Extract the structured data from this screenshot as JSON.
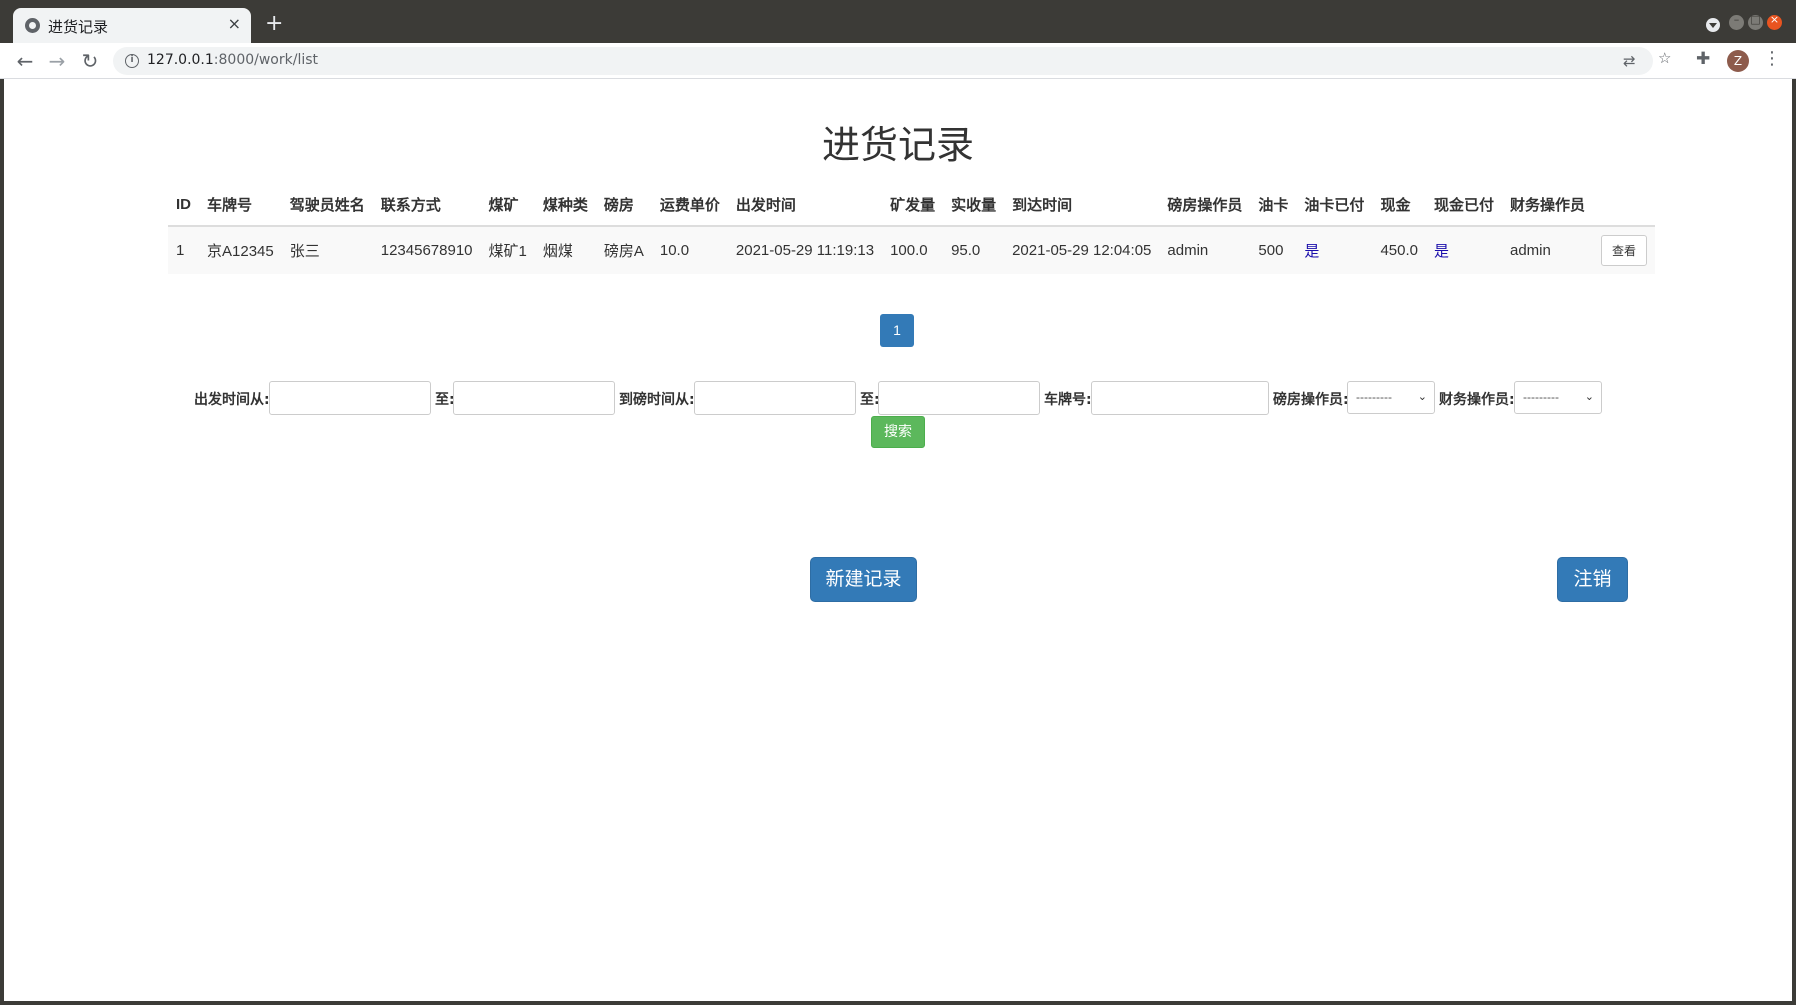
{
  "browser": {
    "tab_title": "进货记录",
    "tab_close": "×",
    "new_tab": "+",
    "url_host": "127.0.0.1",
    "url_path": ":8000/work/list",
    "avatar_letter": "Z",
    "icons": [
      "back-icon",
      "forward-icon",
      "reload-icon",
      "info-icon",
      "translate-icon",
      "bookmark-star-icon",
      "extensions-icon",
      "menu-icon"
    ]
  },
  "page": {
    "title": "进货记录"
  },
  "table": {
    "headers": [
      "ID",
      "车牌号",
      "驾驶员姓名",
      "联系方式",
      "煤矿",
      "煤种类",
      "磅房",
      "运费单价",
      "出发时间",
      "矿发量",
      "实收量",
      "到达时间",
      "磅房操作员",
      "油卡",
      "油卡已付",
      "现金",
      "现金已付",
      "财务操作员",
      ""
    ],
    "rows": [
      {
        "id": "1",
        "plate": "京A12345",
        "driver": "张三",
        "phone": "12345678910",
        "mine": "煤矿1",
        "coal_type": "烟煤",
        "weighhouse": "磅房A",
        "freight_price": "10.0",
        "depart_time": "2021-05-29 11:19:13",
        "mine_amount": "100.0",
        "received_amount": "95.0",
        "arrival_time": "2021-05-29 12:04:05",
        "weigh_operator": "admin",
        "oil_card": "500",
        "oil_card_paid": "是",
        "cash": "450.0",
        "cash_paid": "是",
        "finance_operator": "admin",
        "view_label": "查看"
      }
    ]
  },
  "pagination": {
    "current_page": "1"
  },
  "search": {
    "depart_from_label": "出发时间从:",
    "depart_to_label": "至:",
    "arrive_from_label": "到磅时间从:",
    "arrive_to_label": "至:",
    "plate_label": "车牌号:",
    "weigh_operator_label": "磅房操作员:",
    "weigh_operator_value": "---------",
    "finance_operator_label": "财务操作员:",
    "finance_operator_value": "---------",
    "search_button": "搜索"
  },
  "actions": {
    "new_record": "新建记录",
    "logout": "注销"
  },
  "colors": {
    "primary": "#337ab7",
    "success": "#5cb85c",
    "yes_link": "#1a0dab"
  }
}
